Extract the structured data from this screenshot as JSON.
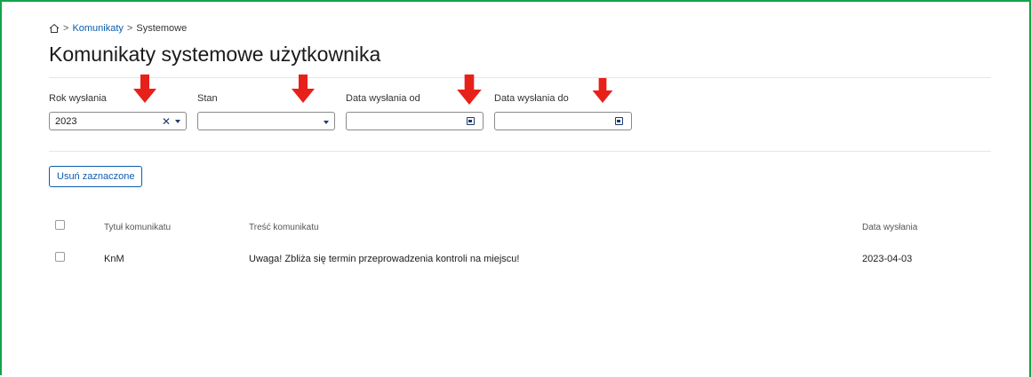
{
  "breadcrumb": {
    "home_icon": "home-icon",
    "link": "Komunikaty",
    "separator": ">",
    "current": "Systemowe"
  },
  "page": {
    "title": "Komunikaty systemowe użytkownika"
  },
  "filters": {
    "year": {
      "label": "Rok wysłania",
      "value": "2023"
    },
    "state": {
      "label": "Stan",
      "value": ""
    },
    "date_from": {
      "label": "Data wysłania od",
      "value": ""
    },
    "date_to": {
      "label": "Data wysłania do",
      "value": ""
    }
  },
  "actions": {
    "delete_selected": "Usuń zaznaczone"
  },
  "table": {
    "headers": {
      "title": "Tytuł komunikatu",
      "content": "Treść komunikatu",
      "date": "Data wysłania"
    },
    "rows": [
      {
        "title": "KnM",
        "content": "Uwaga! Zbliża się termin przeprowadzenia kontroli na miejscu!",
        "date": "2023-04-03"
      }
    ]
  },
  "colors": {
    "frame": "#14a24a",
    "link": "#0b5cad",
    "annotation_arrow": "#e8201a"
  }
}
